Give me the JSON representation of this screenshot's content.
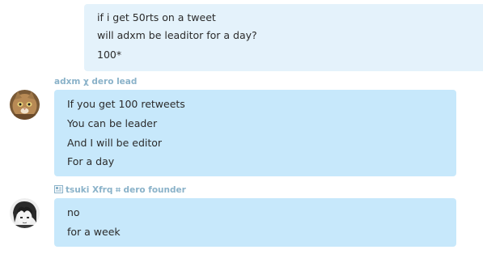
{
  "outgoing": {
    "lines": [
      "if i get 50rts on a tweet",
      "will adxm be leaditor for a day?",
      "100*"
    ]
  },
  "message_1": {
    "sender": "adxm χ dero lead",
    "lines": [
      "If you get 100 retweets",
      "You can be leader",
      "And I will be editor",
      "For a day"
    ]
  },
  "message_2": {
    "sender": "tsuki Χfrq ⌗ dero founder",
    "lines": [
      "no",
      "for a week"
    ]
  },
  "colors": {
    "outgoing_bubble": "#e4f2fb",
    "incoming_bubble": "#c7e8fb",
    "sender_name": "#8ab2c9",
    "text": "#2b2b2b"
  },
  "icons": {
    "sender_2_badge": "id-card-icon",
    "avatar_1": "cat-avatar",
    "avatar_2": "anime-avatar"
  }
}
